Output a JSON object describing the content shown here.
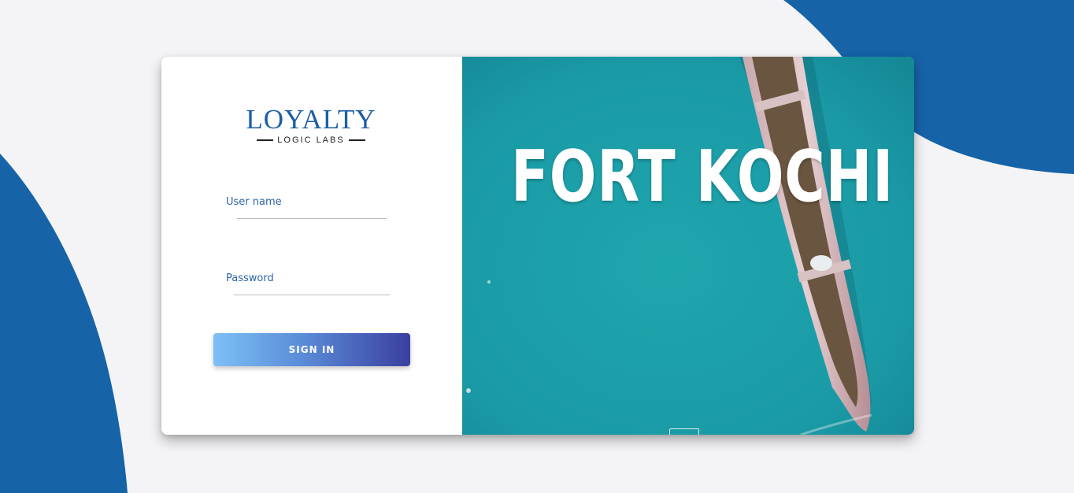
{
  "colors": {
    "page_background": "#f4f4f6",
    "accent_blue": "#1663a8",
    "label_blue": "#2b63a6",
    "logo_blue": "#1c5ea7",
    "sea_teal": "#1ea0a8",
    "button_gradient_start": "#7dc0f5",
    "button_gradient_end": "#3a40a0"
  },
  "logo": {
    "title": "LOYALTY",
    "subtitle": "LOGIC LABS"
  },
  "login_form": {
    "username": {
      "label": "User name",
      "value": ""
    },
    "password": {
      "label": "Password",
      "value": ""
    },
    "signin_label": "SIGN IN"
  },
  "hero": {
    "title": "FORT KOCHI"
  }
}
